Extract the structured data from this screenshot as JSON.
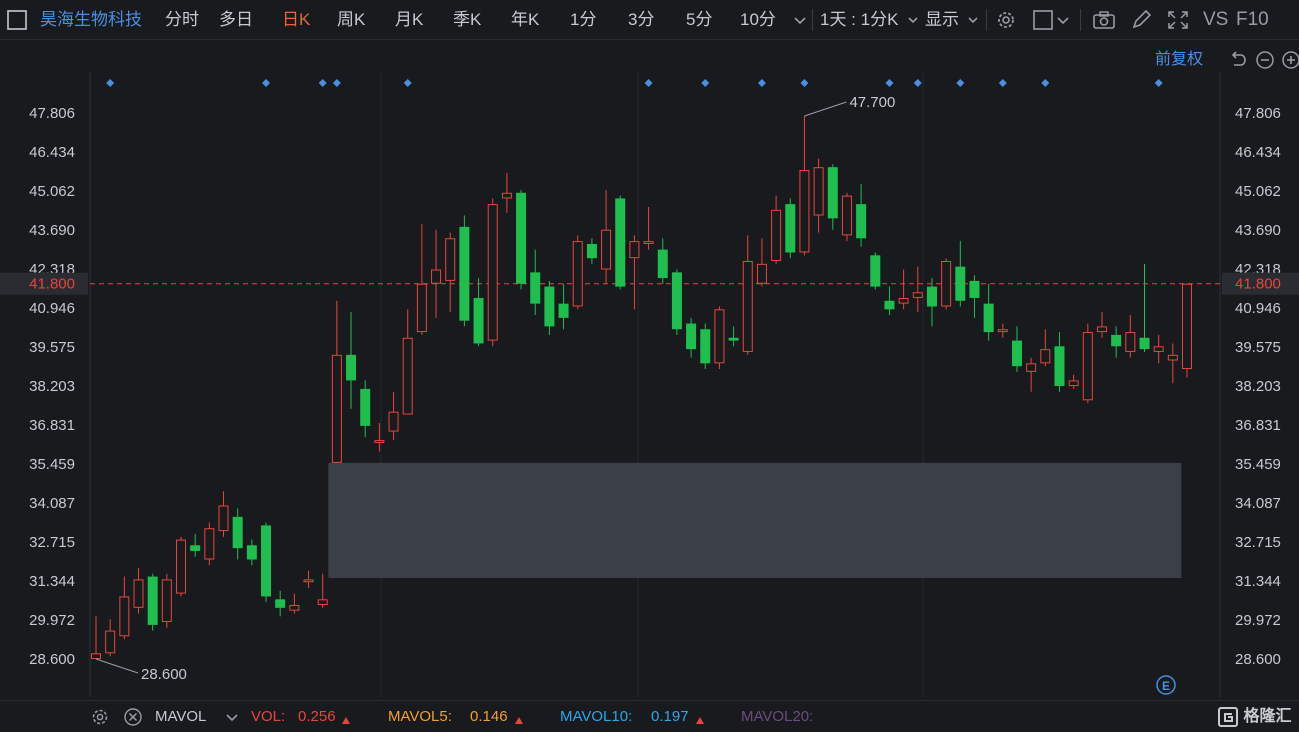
{
  "toolbar": {
    "stock_name": "昊海生物科技",
    "periods": [
      "分时",
      "多日",
      "日K",
      "周K",
      "月K",
      "季K",
      "年K",
      "1分",
      "3分",
      "5分",
      "10分"
    ],
    "active_period": "日K",
    "range_label": "1天 : 1分K",
    "display_label": "显示",
    "vs_label": "VS",
    "f10_label": "F10"
  },
  "sub": {
    "adjust_label": "前复权"
  },
  "chart_data": {
    "type": "candlestick",
    "y_ticks": [
      "47.806",
      "46.434",
      "45.062",
      "43.690",
      "42.318",
      "40.946",
      "39.575",
      "38.203",
      "36.831",
      "35.459",
      "34.087",
      "32.715",
      "31.344",
      "29.972",
      "28.600"
    ],
    "ylim": [
      28.6,
      47.806
    ],
    "current_price": "41.800",
    "high_label": "47.700",
    "low_label": "28.600",
    "highlight_band": [
      31.45,
      35.5
    ],
    "up_color": "#e8453c",
    "down_color": "#1fbf4f",
    "candles": [
      {
        "o": 28.6,
        "c": 28.8,
        "h": 30.1,
        "l": 28.6
      },
      {
        "o": 28.8,
        "c": 29.6,
        "h": 30.0,
        "l": 28.7
      },
      {
        "o": 29.4,
        "c": 30.8,
        "h": 31.5,
        "l": 29.3
      },
      {
        "o": 30.4,
        "c": 31.4,
        "h": 31.8,
        "l": 30.2
      },
      {
        "o": 31.5,
        "c": 29.8,
        "h": 31.6,
        "l": 29.6
      },
      {
        "o": 29.9,
        "c": 31.4,
        "h": 31.6,
        "l": 29.7
      },
      {
        "o": 30.9,
        "c": 32.8,
        "h": 32.9,
        "l": 30.8
      },
      {
        "o": 32.6,
        "c": 32.4,
        "h": 33.0,
        "l": 32.2
      },
      {
        "o": 32.1,
        "c": 33.2,
        "h": 33.4,
        "l": 31.9
      },
      {
        "o": 33.1,
        "c": 34.0,
        "h": 34.5,
        "l": 32.9
      },
      {
        "o": 33.6,
        "c": 32.5,
        "h": 33.9,
        "l": 32.1
      },
      {
        "o": 32.6,
        "c": 32.1,
        "h": 32.8,
        "l": 31.9
      },
      {
        "o": 33.3,
        "c": 30.8,
        "h": 33.4,
        "l": 30.6
      },
      {
        "o": 30.7,
        "c": 30.4,
        "h": 31.0,
        "l": 30.1
      },
      {
        "o": 30.3,
        "c": 30.5,
        "h": 30.9,
        "l": 30.2
      },
      {
        "o": 31.3,
        "c": 31.4,
        "h": 31.7,
        "l": 31.1
      },
      {
        "o": 30.5,
        "c": 30.7,
        "h": 31.6,
        "l": 30.4
      },
      {
        "o": 35.5,
        "c": 39.3,
        "h": 41.2,
        "l": 35.5
      },
      {
        "o": 39.3,
        "c": 38.4,
        "h": 40.8,
        "l": 37.4
      },
      {
        "o": 38.1,
        "c": 36.8,
        "h": 38.4,
        "l": 36.4
      },
      {
        "o": 36.2,
        "c": 36.3,
        "h": 36.9,
        "l": 35.9
      },
      {
        "o": 36.6,
        "c": 37.3,
        "h": 38.0,
        "l": 36.3
      },
      {
        "o": 37.2,
        "c": 39.9,
        "h": 40.9,
        "l": 37.2
      },
      {
        "o": 40.1,
        "c": 41.8,
        "h": 43.9,
        "l": 40.0
      },
      {
        "o": 41.8,
        "c": 42.3,
        "h": 43.7,
        "l": 40.6
      },
      {
        "o": 41.9,
        "c": 43.4,
        "h": 43.6,
        "l": 40.8
      },
      {
        "o": 43.8,
        "c": 40.5,
        "h": 44.2,
        "l": 40.3
      },
      {
        "o": 41.3,
        "c": 39.7,
        "h": 42.0,
        "l": 39.6
      },
      {
        "o": 39.8,
        "c": 44.6,
        "h": 44.8,
        "l": 39.6
      },
      {
        "o": 44.8,
        "c": 45.0,
        "h": 45.7,
        "l": 44.3
      },
      {
        "o": 45.0,
        "c": 41.8,
        "h": 45.1,
        "l": 41.6
      },
      {
        "o": 42.2,
        "c": 41.1,
        "h": 43.0,
        "l": 40.7
      },
      {
        "o": 41.7,
        "c": 40.3,
        "h": 41.9,
        "l": 40.0
      },
      {
        "o": 41.1,
        "c": 40.6,
        "h": 41.8,
        "l": 40.2
      },
      {
        "o": 41.0,
        "c": 43.3,
        "h": 43.5,
        "l": 40.9
      },
      {
        "o": 43.2,
        "c": 42.7,
        "h": 43.4,
        "l": 42.5
      },
      {
        "o": 42.3,
        "c": 43.7,
        "h": 45.1,
        "l": 41.8
      },
      {
        "o": 44.8,
        "c": 41.7,
        "h": 44.9,
        "l": 41.6
      },
      {
        "o": 42.7,
        "c": 43.3,
        "h": 43.5,
        "l": 40.9
      },
      {
        "o": 43.2,
        "c": 43.3,
        "h": 44.5,
        "l": 43.0
      },
      {
        "o": 43.0,
        "c": 42.0,
        "h": 43.4,
        "l": 41.8
      },
      {
        "o": 42.2,
        "c": 40.2,
        "h": 42.3,
        "l": 40.0
      },
      {
        "o": 40.4,
        "c": 39.5,
        "h": 40.6,
        "l": 39.2
      },
      {
        "o": 40.2,
        "c": 39.0,
        "h": 40.4,
        "l": 38.8
      },
      {
        "o": 39.0,
        "c": 40.9,
        "h": 41.0,
        "l": 38.8
      },
      {
        "o": 39.9,
        "c": 39.8,
        "h": 40.3,
        "l": 39.6
      },
      {
        "o": 39.4,
        "c": 42.6,
        "h": 43.5,
        "l": 39.3
      },
      {
        "o": 41.8,
        "c": 42.5,
        "h": 43.4,
        "l": 41.7
      },
      {
        "o": 42.6,
        "c": 44.4,
        "h": 44.9,
        "l": 42.5
      },
      {
        "o": 44.6,
        "c": 42.9,
        "h": 44.8,
        "l": 42.7
      },
      {
        "o": 42.9,
        "c": 45.8,
        "h": 47.7,
        "l": 42.8
      },
      {
        "o": 44.2,
        "c": 45.9,
        "h": 46.2,
        "l": 43.6
      },
      {
        "o": 45.9,
        "c": 44.1,
        "h": 46.0,
        "l": 43.7
      },
      {
        "o": 43.5,
        "c": 44.9,
        "h": 45.0,
        "l": 43.3
      },
      {
        "o": 44.6,
        "c": 43.4,
        "h": 45.3,
        "l": 43.1
      },
      {
        "o": 42.8,
        "c": 41.7,
        "h": 42.9,
        "l": 41.6
      },
      {
        "o": 41.2,
        "c": 40.9,
        "h": 41.7,
        "l": 40.7
      },
      {
        "o": 41.1,
        "c": 41.3,
        "h": 42.3,
        "l": 40.9
      },
      {
        "o": 41.3,
        "c": 41.5,
        "h": 42.4,
        "l": 40.8
      },
      {
        "o": 41.7,
        "c": 41.0,
        "h": 42.0,
        "l": 40.3
      },
      {
        "o": 41.0,
        "c": 42.6,
        "h": 42.7,
        "l": 40.9
      },
      {
        "o": 42.4,
        "c": 41.2,
        "h": 43.3,
        "l": 41.0
      },
      {
        "o": 41.9,
        "c": 41.3,
        "h": 42.1,
        "l": 40.6
      },
      {
        "o": 41.1,
        "c": 40.1,
        "h": 41.8,
        "l": 39.8
      },
      {
        "o": 40.1,
        "c": 40.2,
        "h": 40.4,
        "l": 39.9
      },
      {
        "o": 39.8,
        "c": 38.9,
        "h": 40.3,
        "l": 38.7
      },
      {
        "o": 38.7,
        "c": 39.0,
        "h": 39.2,
        "l": 38.0
      },
      {
        "o": 39.0,
        "c": 39.5,
        "h": 40.2,
        "l": 38.9
      },
      {
        "o": 39.6,
        "c": 38.2,
        "h": 40.1,
        "l": 38.0
      },
      {
        "o": 38.2,
        "c": 38.4,
        "h": 38.6,
        "l": 38.1
      },
      {
        "o": 37.7,
        "c": 40.1,
        "h": 40.4,
        "l": 37.6
      },
      {
        "o": 40.1,
        "c": 40.3,
        "h": 40.8,
        "l": 39.9
      },
      {
        "o": 40.0,
        "c": 39.6,
        "h": 40.3,
        "l": 39.2
      },
      {
        "o": 39.4,
        "c": 40.1,
        "h": 40.7,
        "l": 39.2
      },
      {
        "o": 39.9,
        "c": 39.5,
        "h": 42.5,
        "l": 39.4
      },
      {
        "o": 39.4,
        "c": 39.6,
        "h": 40.0,
        "l": 39.0
      },
      {
        "o": 39.1,
        "c": 39.3,
        "h": 39.7,
        "l": 38.3
      },
      {
        "o": 38.8,
        "c": 41.8,
        "h": 41.8,
        "l": 38.5
      }
    ],
    "marker_slots": [
      1,
      12,
      16,
      17,
      22,
      39,
      43,
      47,
      50,
      56,
      58,
      61,
      64,
      67,
      75
    ]
  },
  "bottom": {
    "indicator": "MAVOL",
    "vol_label": "VOL:",
    "vol_value": "0.256",
    "mavol5_label": "MAVOL5:",
    "mavol5_value": "0.146",
    "mavol10_label": "MAVOL10:",
    "mavol10_value": "0.197",
    "mavol20_label": "MAVOL20:",
    "logo_text": "格隆汇"
  },
  "colors": {
    "blue": "#4a8fe0",
    "orange": "#f0a030",
    "red": "#e8453c",
    "purple": "#6a4c80"
  }
}
